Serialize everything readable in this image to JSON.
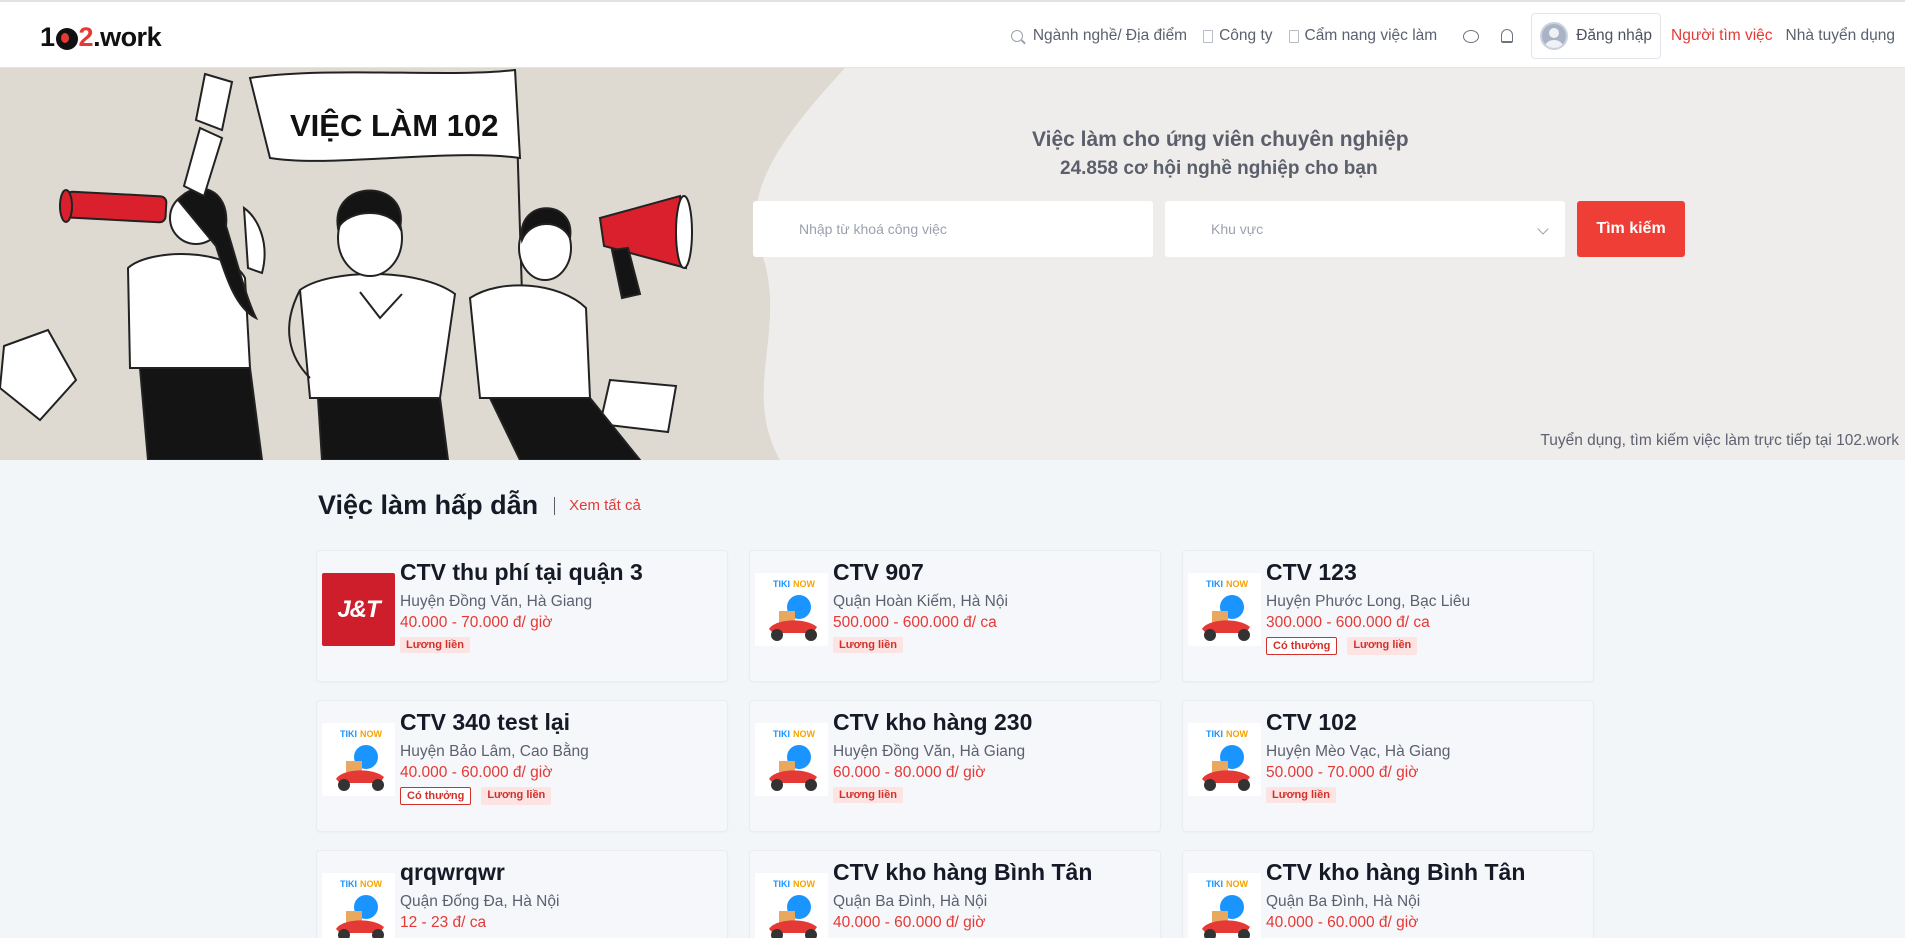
{
  "header": {
    "logo_prefix": "1",
    "logo_two": "2",
    "logo_suffix": ".work",
    "nav": {
      "search_label": "Ngành nghề/ Địa điểm",
      "company_label": "Công ty",
      "handbook_label": "Cẩm nang việc làm",
      "login_label": "Đăng nhập",
      "job_seeker_label": "Người tìm việc",
      "employer_label": "Nhà tuyển dụng"
    }
  },
  "hero": {
    "banner_text": "VIỆC LÀM 102",
    "title": "Việc làm cho ứng viên chuyên nghiệp",
    "subtitle": "24.858 cơ hội nghề nghiệp cho bạn",
    "keyword_placeholder": "Nhập từ khoá công việc",
    "area_placeholder": "Khu vực",
    "search_button": "Tìm kiếm",
    "tagline": "Tuyển dụng, tìm kiếm việc làm trực tiếp tại 102.work"
  },
  "section": {
    "title": "Việc làm hấp dẫn",
    "view_all": "Xem tất cả"
  },
  "colors": {
    "brand_red": "#e53935",
    "button_red": "#ee3e36"
  },
  "jobs": [
    {
      "logo": "J&T",
      "logo_icon": "jt-logo-icon",
      "title": "CTV thu phí tại quận 3",
      "location": "Huyện Đồng Văn, Hà Giang",
      "salary": "40.000 - 70.000 đ/ giờ",
      "tags": [
        {
          "text": "Lương liền",
          "outline": false
        }
      ]
    },
    {
      "logo": "TIKINOW",
      "logo_icon": "tikinow-logo-icon",
      "title": "CTV 907",
      "location": "Quận Hoàn Kiếm, Hà Nội",
      "salary": "500.000 - 600.000 đ/ ca",
      "tags": [
        {
          "text": "Lương liền",
          "outline": false
        }
      ]
    },
    {
      "logo": "TIKINOW",
      "logo_icon": "tikinow-logo-icon",
      "title": "CTV 123",
      "location": "Huyện Phước Long, Bạc Liêu",
      "salary": "300.000 - 600.000 đ/ ca",
      "tags": [
        {
          "text": "Có thưởng",
          "outline": true
        },
        {
          "text": "Lương liền",
          "outline": false
        }
      ]
    },
    {
      "logo": "TIKINOW",
      "logo_icon": "tikinow-logo-icon",
      "title": "CTV 340 test lại",
      "location": "Huyện Bảo Lâm, Cao Bằng",
      "salary": "40.000 - 60.000 đ/ giờ",
      "tags": [
        {
          "text": "Có thưởng",
          "outline": true
        },
        {
          "text": "Lương liền",
          "outline": false
        }
      ]
    },
    {
      "logo": "TIKINOW",
      "logo_icon": "tikinow-logo-icon",
      "title": "CTV kho hàng 230",
      "location": "Huyện Đồng Văn, Hà Giang",
      "salary": "60.000 - 80.000 đ/ giờ",
      "tags": [
        {
          "text": "Lương liền",
          "outline": false
        }
      ]
    },
    {
      "logo": "TIKINOW",
      "logo_icon": "tikinow-logo-icon",
      "title": "CTV 102",
      "location": "Huyện Mèo Vạc, Hà Giang",
      "salary": "50.000 - 70.000 đ/ giờ",
      "tags": [
        {
          "text": "Lương liền",
          "outline": false
        }
      ]
    },
    {
      "logo": "TIKINOW",
      "logo_icon": "tikinow-logo-icon",
      "title": "qrqwrqwr",
      "location": "Quận Đống Đa, Hà Nội",
      "salary": "12 - 23 đ/ ca",
      "tags": []
    },
    {
      "logo": "TIKINOW",
      "logo_icon": "tikinow-logo-icon",
      "title": "CTV kho hàng Bình Tân",
      "location": "Quận Ba Đình, Hà Nội",
      "salary": "40.000 - 60.000 đ/ giờ",
      "tags": []
    },
    {
      "logo": "TIKINOW",
      "logo_icon": "tikinow-logo-icon",
      "title": "CTV kho hàng Bình Tân",
      "location": "Quận Ba Đình, Hà Nội",
      "salary": "40.000 - 60.000 đ/ giờ",
      "tags": []
    }
  ]
}
